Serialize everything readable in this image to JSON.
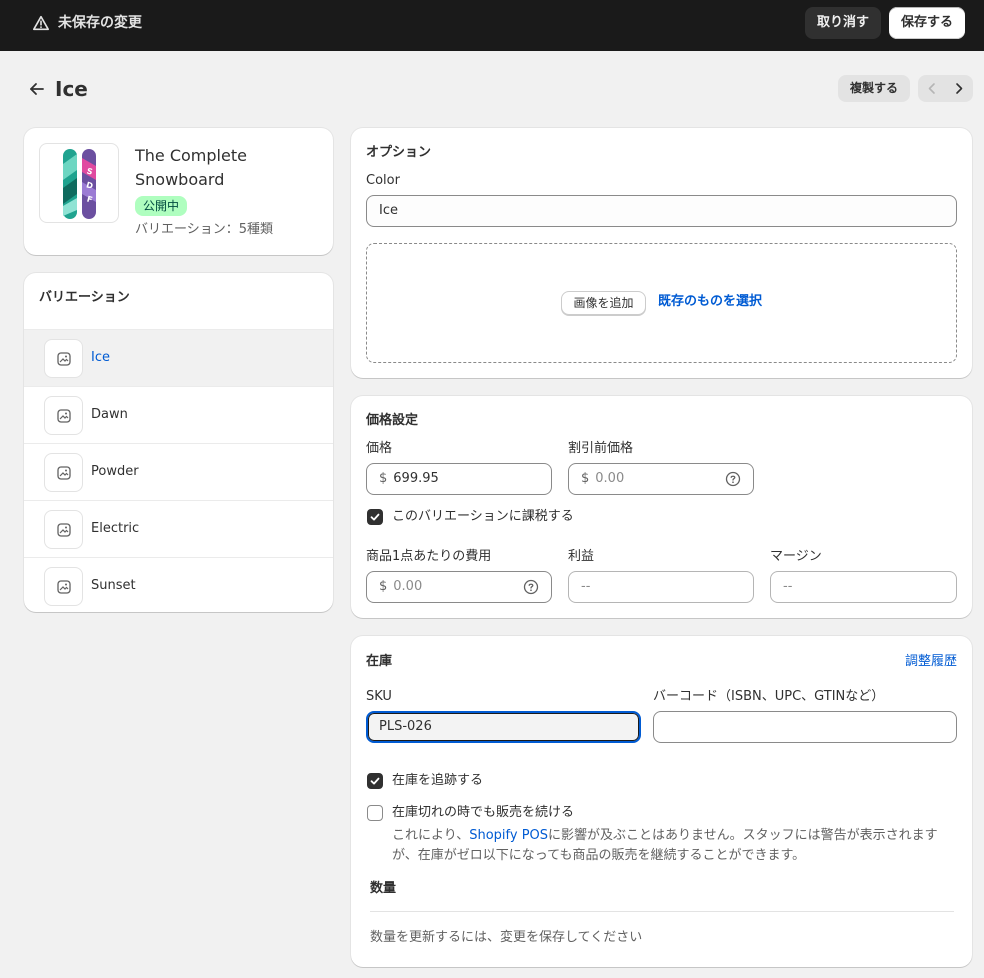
{
  "topbar": {
    "warning_icon": "alert-triangle-icon",
    "unsaved_text": "未保存の変更",
    "discard_label": "取り消す",
    "save_label": "保存する"
  },
  "header": {
    "title": "Ice",
    "duplicate_label": "複製する",
    "prev_icon": "chevron-left-icon",
    "next_icon": "chevron-right-icon"
  },
  "product": {
    "name": "The Complete Snowboard",
    "status": "公開中",
    "variant_count": "バリエーション：5種類"
  },
  "variants": {
    "title": "バリエーション",
    "items": [
      {
        "label": "Ice",
        "active": true
      },
      {
        "label": "Dawn",
        "active": false
      },
      {
        "label": "Powder",
        "active": false
      },
      {
        "label": "Electric",
        "active": false
      },
      {
        "label": "Sunset",
        "active": false
      }
    ]
  },
  "options": {
    "title": "オプション",
    "color_label": "Color",
    "color_value": "Ice",
    "add_image_label": "画像を追加",
    "select_existing_label": "既存のものを選択"
  },
  "pricing": {
    "title": "価格設定",
    "price_label": "価格",
    "currency": "$",
    "price_value": "699.95",
    "compare_label": "割引前価格",
    "compare_placeholder": "0.00",
    "taxable_label": "このバリエーションに課税する",
    "taxable_checked": true,
    "cost_label": "商品1点あたりの費用",
    "cost_placeholder": "0.00",
    "profit_label": "利益",
    "profit_value": "--",
    "margin_label": "マージン",
    "margin_value": "--"
  },
  "inventory": {
    "title": "在庫",
    "history_link": "調整履歴",
    "sku_label": "SKU",
    "sku_value": "PLS-026",
    "barcode_label": "バーコード（ISBN、UPC、GTINなど）",
    "barcode_value": "",
    "track_label": "在庫を追跡する",
    "track_checked": true,
    "continue_label": "在庫切れの時でも販売を続ける",
    "continue_checked": false,
    "note_pre": "これにより、",
    "note_link": "Shopify POS",
    "note_post": "に影響が及ぶことはありません。スタッフには警告が表示されますが、在庫がゼロ以下になっても商品の販売を継続することができます。",
    "quantity_title": "数量",
    "quantity_note": "数量を更新するには、変更を保存してください"
  },
  "colors": {
    "topbar_bg": "#1a1a1a",
    "link": "#005bd3",
    "badge_bg": "#affebf",
    "badge_text": "#014b40",
    "focus": "#005bd3"
  }
}
